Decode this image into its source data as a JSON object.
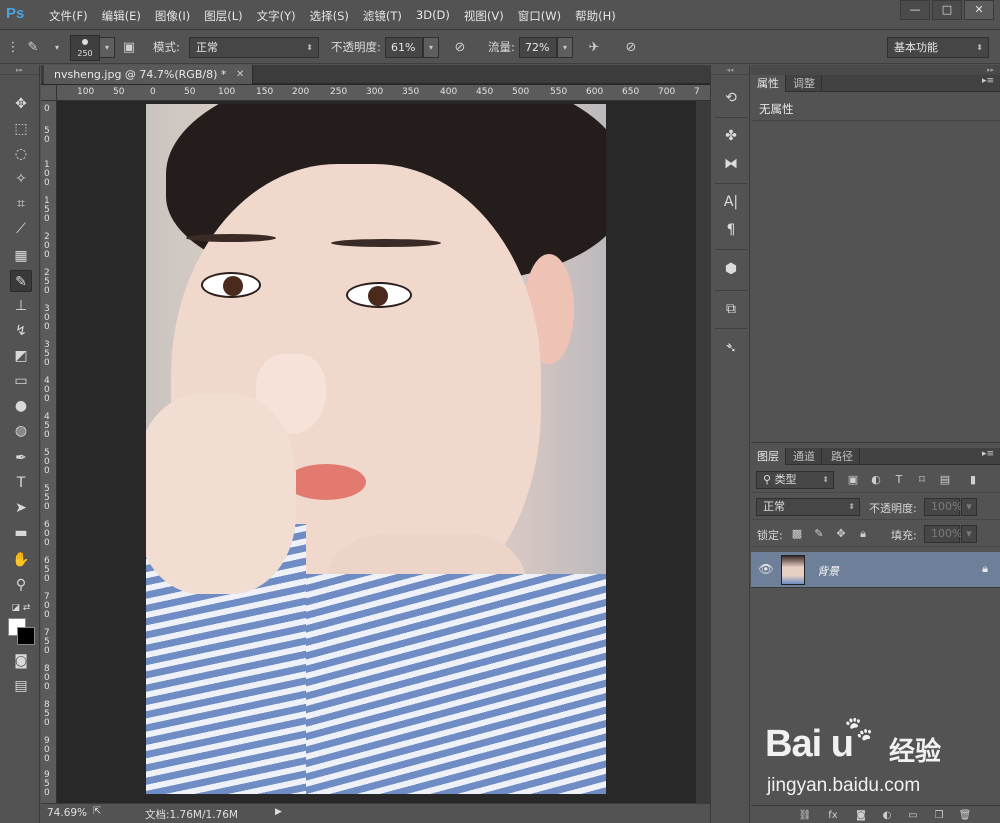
{
  "app": {
    "logo": "Ps"
  },
  "menu": [
    "文件(F)",
    "编辑(E)",
    "图像(I)",
    "图层(L)",
    "文字(Y)",
    "选择(S)",
    "滤镜(T)",
    "3D(D)",
    "视图(V)",
    "窗口(W)",
    "帮助(H)"
  ],
  "window_controls": {
    "minimize": "—",
    "maximize": "□",
    "close": "✕"
  },
  "options": {
    "brush_size": "250",
    "mode_label": "模式:",
    "mode_value": "正常",
    "opacity_label": "不透明度:",
    "opacity_value": "61%",
    "flow_label": "流量:",
    "flow_value": "72%",
    "workspace": "基本功能"
  },
  "document": {
    "tab_title": "nvsheng.jpg @ 74.7%(RGB/8) *",
    "zoom": "74.69%",
    "info": "文档:1.76M/1.76M",
    "ruler_h": [
      "100",
      "50",
      "0",
      "50",
      "100",
      "150",
      "200",
      "250",
      "300",
      "350",
      "400",
      "450",
      "500",
      "550",
      "600",
      "650",
      "700",
      "7"
    ],
    "ruler_v": [
      "0",
      "5\n0",
      "1\n0\n0",
      "1\n5\n0",
      "2\n0\n0",
      "2\n5\n0",
      "3\n0\n0",
      "3\n5\n0",
      "4\n0\n0",
      "4\n5\n0",
      "5\n0\n0",
      "5\n5\n0",
      "6\n0\n0",
      "6\n5\n0",
      "7\n0\n0",
      "7\n5\n0",
      "8\n0\n0",
      "8\n5\n0",
      "9\n0\n0",
      "9\n5\n0"
    ]
  },
  "properties_panel": {
    "tab_properties": "属性",
    "tab_adjustments": "调整",
    "content": "无属性"
  },
  "layers_panel": {
    "tab_layers": "图层",
    "tab_channels": "通道",
    "tab_paths": "路径",
    "filter_kind": "类型",
    "blend_mode": "正常",
    "opacity_label": "不透明度:",
    "opacity_value": "100%",
    "lock_label": "锁定:",
    "fill_label": "填充:",
    "fill_value": "100%",
    "layer_name": "背景"
  },
  "watermark": {
    "logo": "Bai  u",
    "cn": "经验",
    "url": "jingyan.baidu.com"
  }
}
